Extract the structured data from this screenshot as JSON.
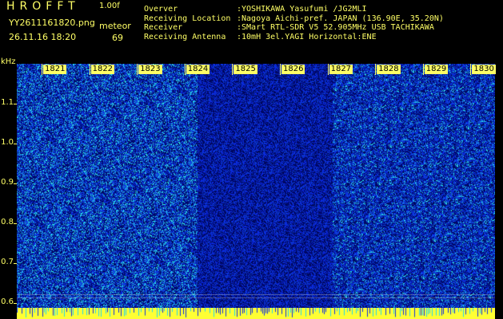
{
  "header": {
    "app_name": "HROFFT",
    "version": "1.00f",
    "filename": "YY2611161820.png",
    "datetime": "26.11.16 18:20",
    "mode": "meteor",
    "count": "69"
  },
  "station": [
    {
      "label": "Overver",
      "value": ":YOSHIKAWA Yasufumi /JG2MLI"
    },
    {
      "label": "Receiving Location",
      "value": ":Nagoya Aichi-pref. JAPAN (136.90E, 35.20N)"
    },
    {
      "label": "Receiver",
      "value": ":SMart RTL-SDR V5 52.905MHz USB TACHIKAWA"
    },
    {
      "label": "Receiving Antenna",
      "value": ":10mH 3el.YAGI Horizontal:ENE"
    }
  ],
  "axis": {
    "y_unit": "kHz",
    "y_ticks": [
      {
        "value": 1.1,
        "label": "1.1"
      },
      {
        "value": 1.0,
        "label": "1.0"
      },
      {
        "value": 0.9,
        "label": "0.9"
      },
      {
        "value": 0.8,
        "label": "0.8"
      },
      {
        "value": 0.7,
        "label": "0.7"
      },
      {
        "value": 0.6,
        "label": "0.6"
      }
    ],
    "x_ticks": [
      "1821",
      "1822",
      "1823",
      "1824",
      "1825",
      "1826",
      "1827",
      "1828",
      "1829",
      "1830"
    ]
  },
  "colors": {
    "label": "#ffff66",
    "background": "#000000",
    "noise_low": "#000a5c",
    "noise_mid": "#0a2ad0",
    "noise_high": "#22d8ee",
    "ping": "#ffff33"
  }
}
